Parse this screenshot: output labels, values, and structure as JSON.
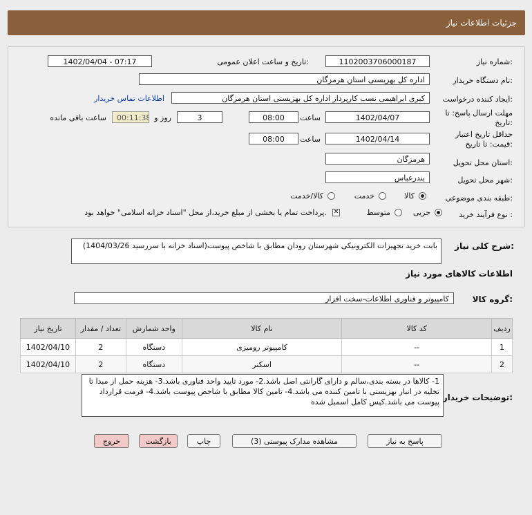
{
  "header": {
    "title": "جزئیات اطلاعات نیاز"
  },
  "form": {
    "need_number_label": "شماره نیاز:",
    "need_number": "1102003706000187",
    "announce_label": "تاریخ و ساعت اعلان عمومی:",
    "announce_value": "1402/04/04 - 07:17",
    "buyer_org_label": "نام دستگاه خریدار:",
    "buyer_org": "اداره کل بهزیستی استان هرمزگان",
    "requester_label": "ایجاد کننده درخواست:",
    "requester": "کبری  ابراهیمی نسب کارپرداز اداره کل بهزیستی استان هرمزگان",
    "contact_link": "اطلاعات تماس خریدار",
    "reply_deadline_label_1": "مهلت ارسال پاسخ: تا",
    "reply_deadline_label_2": "تاریخ:",
    "reply_date": "1402/04/07",
    "time_label": "ساعت",
    "reply_time": "08:00",
    "days_value": "3",
    "days_label": "روز و",
    "timer_value": "00:11:38",
    "remaining_label": "ساعت باقی مانده",
    "price_validity_label_1": "حداقل تاریخ اعتبار",
    "price_validity_label_2": "قیمت: تا تاریخ:",
    "validity_date": "1402/04/14",
    "validity_time_label": "ساعت",
    "validity_time": "08:00",
    "province_label": "استان محل تحویل:",
    "province": "هرمزگان",
    "city_label": "شهر محل تحویل:",
    "city": "بندرعباس",
    "category_label": "طبقه بندی موضوعی:",
    "category_options": [
      "کالا",
      "خدمت",
      "کالا/خدمت"
    ],
    "process_label": "نوع فرآیند خرید :",
    "process_options": [
      "جزیی",
      "متوسط"
    ],
    "payment_note": "پرداخت تمام یا بخشی از مبلغ خرید،از محل \"اسناد خزانه اسلامی\" خواهد بود."
  },
  "summary": {
    "label": "شرح کلی نیاز:",
    "text": "بابت خرید تجهیزات الکترونیکی شهرستان رودان مطابق با شاخص پیوست(اسناد خزانه با سررسید 1404/03/26)"
  },
  "goods_info_title": "اطلاعات کالاهای مورد نیاز",
  "goods_group": {
    "label": "گروه کالا:",
    "value": "کامپیوتر و فناوری اطلاعات-سخت افزار"
  },
  "table": {
    "headers": [
      "ردیف",
      "کد کالا",
      "نام کالا",
      "واحد شمارش",
      "تعداد / مقدار",
      "تاریخ نیاز"
    ],
    "rows": [
      [
        "1",
        "--",
        "کامپیوتر رومیزی",
        "دستگاه",
        "2",
        "1402/04/10"
      ],
      [
        "2",
        "--",
        "اسکنر",
        "دستگاه",
        "2",
        "1402/04/10"
      ]
    ]
  },
  "notes": {
    "label": "توضیحات خریدار:",
    "text": "1- کالاها در بسته بندی،سالم و دارای گارانتی اصل باشد.2- مورد تایید واحد فناوری باشد.3- هزینه حمل از مبدا تا تخلیه در انبار بهزیستی با تامین کننده می باشد.4- تامین کالا مطابق با شاخص پیوست باشد.4- فرمت قرارداد  پیوست می باشد.کیس کامل اسمبل شده"
  },
  "buttons": {
    "reply": "پاسخ به نیاز",
    "attachments": "مشاهده مدارک پیوستی (3)",
    "print": "چاپ",
    "back": "بازگشت",
    "exit": "خروج"
  }
}
